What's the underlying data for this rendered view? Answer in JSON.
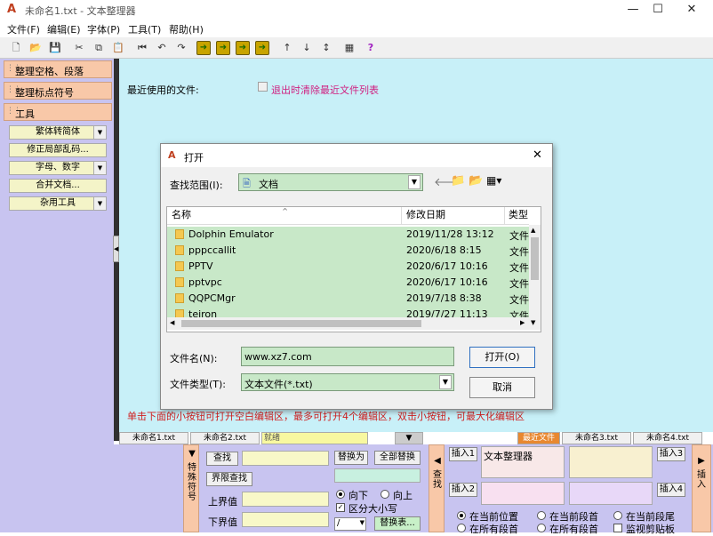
{
  "window": {
    "title": "未命名1.txt - 文本整理器",
    "minimize": "—",
    "maximize": "☐",
    "close": "✕"
  },
  "menu": [
    "文件(F)",
    "编辑(E)",
    "字体(P)",
    "工具(T)",
    "帮助(H)"
  ],
  "left_panel": {
    "sections": [
      "整理空格、段落",
      "整理标点符号",
      "工具"
    ],
    "buttons": [
      "繁体转简体",
      "修正局部乱码...",
      "字母、数字",
      "合并文档...",
      "杂用工具"
    ]
  },
  "main": {
    "recent_label": "最近使用的文件:",
    "clear_label": "退出时清除最近文件列表",
    "hint": "单击下面的小按钮可打开空白编辑区，最多可打开4个编辑区，双击小按钮，可最大化编辑区"
  },
  "tabs": {
    "tab1": "未命名1.txt",
    "tab2": "未命名2.txt",
    "status": "就绪",
    "recent": "最近文件",
    "tab3": "未命名3.txt",
    "tab4": "未命名4.txt"
  },
  "bottom": {
    "special_chars": "特殊符号",
    "find_vert": "查找",
    "insert_vert": "插入",
    "find_btn": "查找",
    "boundary_find_btn": "界限查找",
    "upper_label": "上界值",
    "lower_label": "下界值",
    "replace_btn": "替换为",
    "replace_all_btn": "全部替换",
    "down_label": "向下",
    "up_label": "向上",
    "case_label": "区分大小写",
    "slash_value": "/",
    "replace_table_btn": "替换表...",
    "insert1": "插入1",
    "insert2": "插入2",
    "insert3": "插入3",
    "insert4": "插入4",
    "insert1_text": "文本整理器",
    "opt_cur_pos": "在当前位置",
    "opt_cur_para_start": "在当前段首",
    "opt_cur_para_end": "在当前段尾",
    "opt_all_para_start": "在所有段首",
    "opt_all_para_start2": "在所有段首",
    "opt_monitor_clip": "监视剪贴板"
  },
  "dialog": {
    "title": "打开",
    "look_in_label": "查找范围(I):",
    "look_in_value": "文档",
    "col_name": "名称",
    "col_date": "修改日期",
    "col_type": "类型",
    "files": [
      {
        "name": "Dolphin Emulator",
        "date": "2019/11/28 13:12",
        "type": "文件"
      },
      {
        "name": "pppccallit",
        "date": "2020/6/18 8:15",
        "type": "文件"
      },
      {
        "name": "PPTV",
        "date": "2020/6/17 10:16",
        "type": "文件"
      },
      {
        "name": "pptvpc",
        "date": "2020/6/17 10:16",
        "type": "文件"
      },
      {
        "name": "QQPCMgr",
        "date": "2019/7/18 8:38",
        "type": "文件"
      },
      {
        "name": "teiron",
        "date": "2019/7/27 11:13",
        "type": "文件"
      }
    ],
    "filename_label": "文件名(N):",
    "filename_value": "www.xz7.com",
    "filetype_label": "文件类型(T):",
    "filetype_value": "文本文件(*.txt)",
    "open_btn": "打开(O)",
    "cancel_btn": "取消"
  }
}
